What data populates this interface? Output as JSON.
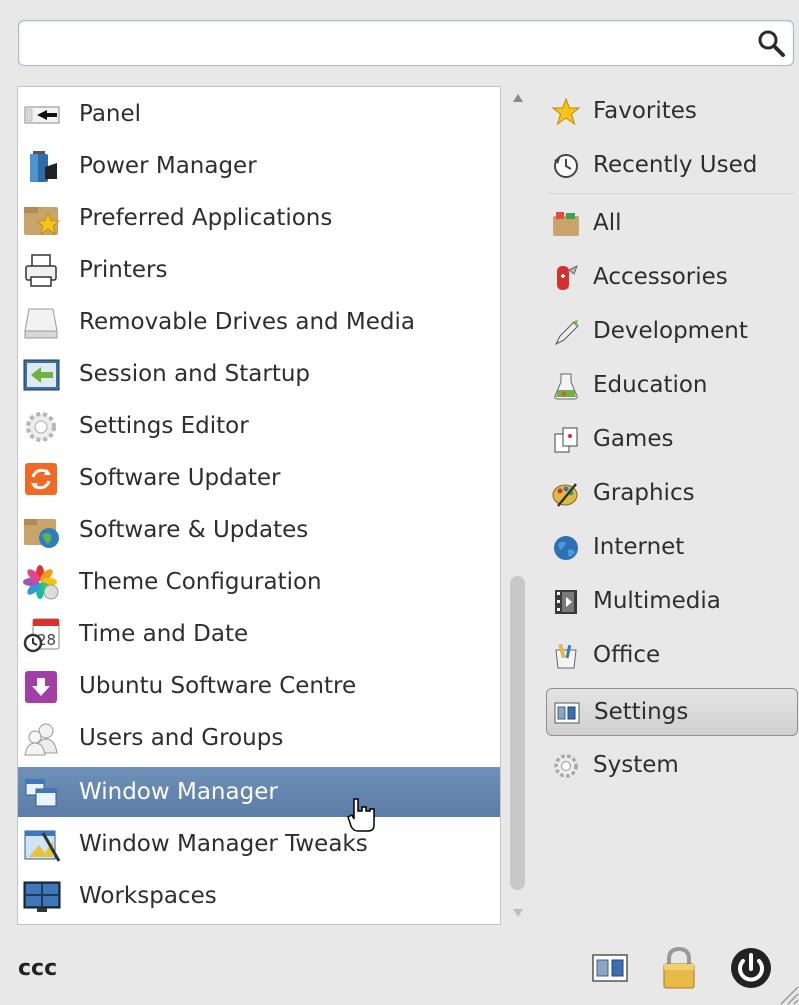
{
  "search": {
    "value": "",
    "placeholder": ""
  },
  "applications": [
    {
      "label": "Panel",
      "icon": "panel-icon"
    },
    {
      "label": "Power Manager",
      "icon": "power-manager-icon"
    },
    {
      "label": "Preferred Applications",
      "icon": "preferred-applications-icon"
    },
    {
      "label": "Printers",
      "icon": "printer-icon"
    },
    {
      "label": "Removable Drives and Media",
      "icon": "removable-drive-icon"
    },
    {
      "label": "Session and Startup",
      "icon": "session-startup-icon"
    },
    {
      "label": "Settings Editor",
      "icon": "settings-editor-icon"
    },
    {
      "label": "Software Updater",
      "icon": "software-updater-icon"
    },
    {
      "label": "Software & Updates",
      "icon": "software-sources-icon"
    },
    {
      "label": "Theme Configuration",
      "icon": "theme-configuration-icon"
    },
    {
      "label": "Time and Date",
      "icon": "time-date-icon"
    },
    {
      "label": "Ubuntu Software Centre",
      "icon": "software-centre-icon"
    },
    {
      "label": "Users and Groups",
      "icon": "users-groups-icon"
    },
    {
      "label": "Window Manager",
      "icon": "window-manager-icon",
      "selected": true
    },
    {
      "label": "Window Manager Tweaks",
      "icon": "window-manager-tweaks-icon"
    },
    {
      "label": "Workspaces",
      "icon": "workspaces-icon"
    }
  ],
  "categories": [
    {
      "label": "Favorites",
      "icon": "star-icon"
    },
    {
      "label": "Recently Used",
      "icon": "clock-icon"
    },
    {
      "label": "All",
      "icon": "all-icon"
    },
    {
      "label": "Accessories",
      "icon": "accessories-icon"
    },
    {
      "label": "Development",
      "icon": "development-icon"
    },
    {
      "label": "Education",
      "icon": "education-icon"
    },
    {
      "label": "Games",
      "icon": "games-icon"
    },
    {
      "label": "Graphics",
      "icon": "graphics-icon"
    },
    {
      "label": "Internet",
      "icon": "globe-icon"
    },
    {
      "label": "Multimedia",
      "icon": "multimedia-icon"
    },
    {
      "label": "Office",
      "icon": "office-icon"
    },
    {
      "label": "Settings",
      "icon": "settings-icon",
      "selected": true
    },
    {
      "label": "System",
      "icon": "gear-icon"
    }
  ],
  "user": {
    "name": "ccc"
  },
  "colors": {
    "selection": "#5f82ab",
    "background": "#e8e8e8",
    "list_background": "#ffffff"
  }
}
